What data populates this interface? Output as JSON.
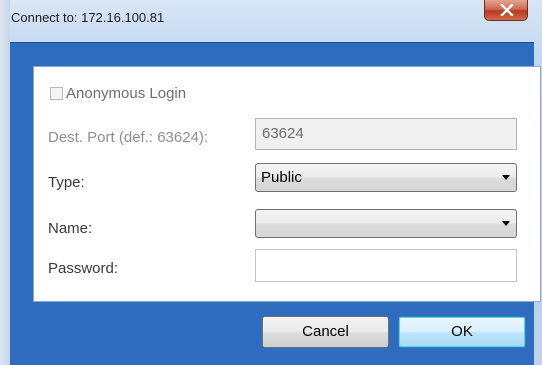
{
  "window": {
    "title": "Connect to: 172.16.100.81",
    "close_icon": "close-x-icon"
  },
  "form": {
    "anonymous_login": {
      "label": "Anonymous Login",
      "checked": false
    },
    "dest_port": {
      "label": "Dest. Port (def.: 63624):",
      "value": "63624",
      "enabled": false
    },
    "type": {
      "label": "Type:",
      "value": "Public"
    },
    "name": {
      "label": "Name:",
      "value": ""
    },
    "password": {
      "label": "Password:",
      "value": ""
    }
  },
  "buttons": {
    "cancel": "Cancel",
    "ok": "OK"
  },
  "colors": {
    "frame_blue": "#2e6cc0",
    "close_red": "#c7472b"
  }
}
